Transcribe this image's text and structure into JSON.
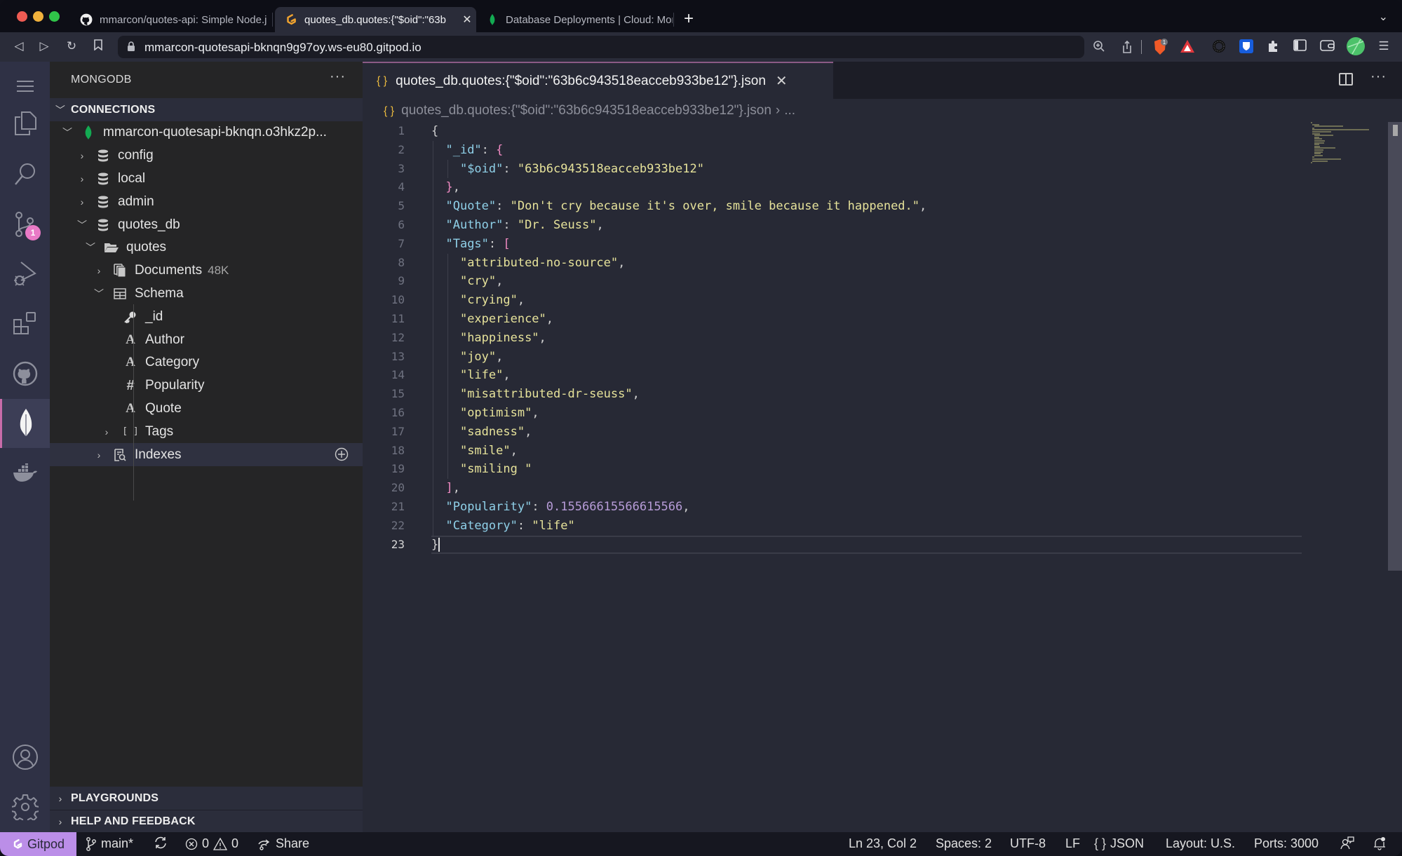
{
  "browser": {
    "tabs": [
      {
        "title": "mmarcon/quotes-api: Simple Node.j",
        "icon": "github-icon",
        "active": false
      },
      {
        "title": "quotes_db.quotes:{\"$oid\":\"63b",
        "icon": "gitpod-icon",
        "active": true
      },
      {
        "title": "Database Deployments | Cloud: Mor",
        "icon": "mongodb-leaf-icon",
        "active": false
      }
    ],
    "new_tab": "+",
    "url": "mmarcon-quotesapi-bknqn9g97oy.ws-eu80.gitpod.io",
    "brave_badge": "1"
  },
  "activity_bar": {
    "items": [
      "menu-icon",
      "explorer-icon",
      "search-icon",
      "source-control-icon",
      "run-debug-icon",
      "extensions-icon",
      "github-icon",
      "mongodb-icon",
      "docker-icon"
    ],
    "scm_badge": "1",
    "bottom": [
      "account-icon",
      "settings-gear-icon"
    ]
  },
  "sidebar": {
    "title": "MONGODB",
    "more": "···",
    "connections_label": "CONNECTIONS",
    "connection": "mmarcon-quotesapi-bknqn.o3hkz2p...",
    "databases": [
      "config",
      "local",
      "admin",
      "quotes_db"
    ],
    "collection": "quotes",
    "documents_label": "Documents",
    "documents_count": "48K",
    "schema_label": "Schema",
    "fields": [
      {
        "name": "_id",
        "type": "key"
      },
      {
        "name": "Author",
        "type": "string"
      },
      {
        "name": "Category",
        "type": "string"
      },
      {
        "name": "Popularity",
        "type": "number"
      },
      {
        "name": "Quote",
        "type": "string"
      },
      {
        "name": "Tags",
        "type": "array"
      }
    ],
    "indexes_label": "Indexes",
    "playgrounds_label": "PLAYGROUNDS",
    "help_label": "HELP AND FEEDBACK"
  },
  "editor": {
    "tab_title": "quotes_db.quotes:{\"$oid\":\"63b6c943518eacceb933be12\"}.json",
    "breadcrumb": "quotes_db.quotes:{\"$oid\":\"63b6c943518eacceb933be12\"}.json",
    "breadcrumb_more": "...",
    "document": {
      "oid": "63b6c943518eacceb933be12",
      "Quote": "Don't cry because it's over, smile because it happened.",
      "Author": "Dr. Seuss",
      "Tags": [
        "attributed-no-source",
        "cry",
        "crying",
        "experience",
        "happiness",
        "joy",
        "life",
        "misattributed-dr-seuss",
        "optimism",
        "sadness",
        "smile",
        "smiling "
      ],
      "Popularity": "0.15566615566615566",
      "Category": "life"
    },
    "line_count": 23,
    "current_line": 23
  },
  "statusbar": {
    "remote": "Gitpod",
    "branch": "main*",
    "errors": "0",
    "warnings": "0",
    "share": "Share",
    "position": "Ln 23, Col 2",
    "spaces": "Spaces: 2",
    "encoding": "UTF-8",
    "eol": "LF",
    "language": "JSON",
    "layout": "Layout: U.S.",
    "ports": "Ports: 3000"
  }
}
